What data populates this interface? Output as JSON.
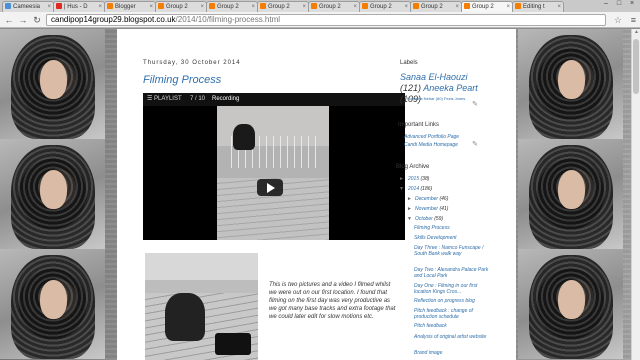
{
  "browser": {
    "tabs": [
      {
        "label": "Cameesia",
        "icon": "blogger-icon",
        "color": "#4a90d9"
      },
      {
        "label": "| Hus - D",
        "icon": "youtube-icon",
        "color": "#e02a20"
      },
      {
        "label": "Blogger",
        "icon": "blogger-icon",
        "color": "#f57d00"
      },
      {
        "label": "Group 2",
        "icon": "blogger-icon",
        "color": "#f57d00"
      },
      {
        "label": "Group 2",
        "icon": "blogger-icon",
        "color": "#f57d00"
      },
      {
        "label": "Group 2",
        "icon": "blogger-icon",
        "color": "#f57d00"
      },
      {
        "label": "Group 2",
        "icon": "blogger-icon",
        "color": "#f57d00"
      },
      {
        "label": "Group 2",
        "icon": "blogger-icon",
        "color": "#f57d00"
      },
      {
        "label": "Group 2",
        "icon": "blogger-icon",
        "color": "#f57d00"
      },
      {
        "label": "Group 2",
        "icon": "blogger-icon",
        "color": "#f57d00"
      },
      {
        "label": "Editing t",
        "icon": "blogger-icon",
        "color": "#f57d00"
      }
    ],
    "active_tab": 9,
    "url_host": "candipop14group29.blogspot.co.uk",
    "url_path": "/2014/10/filming-process.html"
  },
  "post": {
    "date": "Thursday, 30 October 2014",
    "title": "Filming Process",
    "video": {
      "playlist_label": "PLAYLIST",
      "count": "7 / 10",
      "title": "Recording"
    },
    "body": "This is two pictures and a video I filmed whilst we were out on our first location. I found that filming on the first day was very productive as we got many base tracks and extra footage that we could later edit for slow motions etc."
  },
  "sidebar": {
    "labels_heading": "Labels",
    "labels_big": [
      {
        "name": "Sanaa El-Haouzi",
        "count": "(121)"
      },
      {
        "name": "Aneeka Peart",
        "count": "(109)"
      }
    ],
    "labels_small": "Fornisha Nehar (60) Fezis Jones",
    "links_heading": "Important Links",
    "links": [
      "Advanced Portfolio Page",
      "Candi Media Homepage"
    ],
    "archive_heading": "Blog Archive",
    "archive_years": [
      {
        "year": "2015",
        "count": "(38)"
      },
      {
        "year": "2014",
        "count": "(186)"
      }
    ],
    "archive_months": [
      {
        "month": "December",
        "count": "(46)"
      },
      {
        "month": "November",
        "count": "(41)"
      },
      {
        "month": "October",
        "count": "(59)"
      }
    ],
    "archive_posts": [
      "Filming Process",
      "Skills Development",
      "Day Three : Namco Funscape / South Bank walk way",
      "Day Two : Alexandra Palace Park and Local Park",
      "Day One : Filming in our first location Kings Cros...",
      "Reflection on progress blog",
      "Pitch feedback : change of production schedule",
      "Pitch feedback",
      "Analysis of original artist website",
      "Brand image"
    ]
  }
}
